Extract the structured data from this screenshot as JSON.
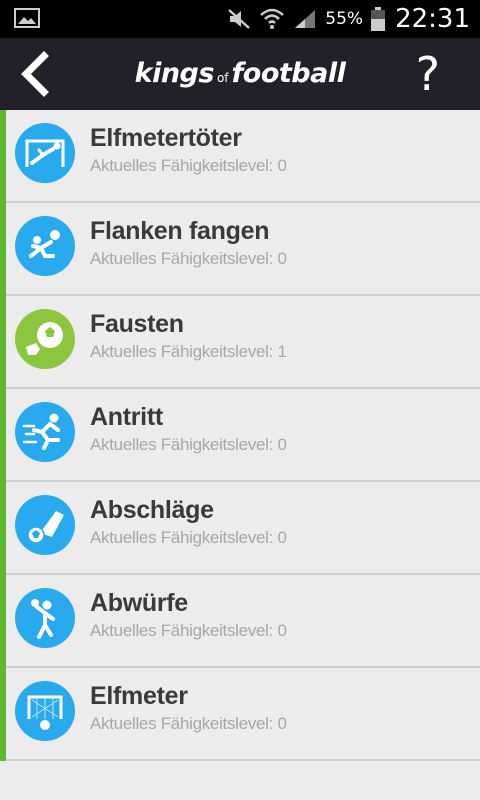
{
  "status_bar": {
    "battery_percent": "55%",
    "time": "22:31"
  },
  "header": {
    "logo_part1": "kings",
    "logo_part2": "of",
    "logo_part3": "football",
    "help_label": "?"
  },
  "skills": [
    {
      "title": "Elfmetertöter",
      "subtitle": "Aktuelles Fähigkeitslevel: 0",
      "icon": "goalkeeper-dive-icon",
      "color": "#29a9ee"
    },
    {
      "title": "Flanken fangen",
      "subtitle": "Aktuelles Fähigkeitslevel: 0",
      "icon": "catching-cross-icon",
      "color": "#29a9ee"
    },
    {
      "title": "Fausten",
      "subtitle": "Aktuelles Fähigkeitslevel: 1",
      "icon": "punching-ball-icon",
      "color": "#8cc63f"
    },
    {
      "title": "Antritt",
      "subtitle": "Aktuelles Fähigkeitslevel: 0",
      "icon": "sprinting-icon",
      "color": "#29a9ee"
    },
    {
      "title": "Abschläge",
      "subtitle": "Aktuelles Fähigkeitslevel: 0",
      "icon": "goal-kick-icon",
      "color": "#29a9ee"
    },
    {
      "title": "Abwürfe",
      "subtitle": "Aktuelles Fähigkeitslevel: 0",
      "icon": "throw-icon",
      "color": "#29a9ee"
    },
    {
      "title": "Elfmeter",
      "subtitle": "Aktuelles Fähigkeitslevel: 0",
      "icon": "penalty-goal-icon",
      "color": "#29a9ee"
    }
  ],
  "colors": {
    "header_bg": "#23202a",
    "accent_green": "#5cb82e",
    "icon_blue": "#29a9ee",
    "icon_green": "#8cc63f"
  }
}
